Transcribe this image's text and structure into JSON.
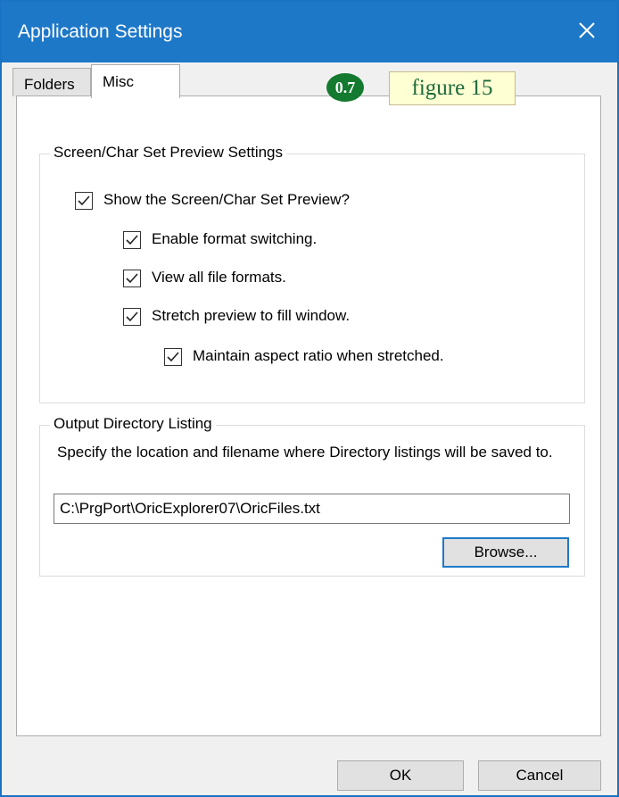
{
  "window": {
    "title": "Application Settings"
  },
  "tabs": [
    {
      "label": "Folders",
      "selected": false
    },
    {
      "label": "Misc",
      "selected": true
    }
  ],
  "annotation": {
    "badge": "0.7",
    "figure_label": "figure 15"
  },
  "preview_group": {
    "legend": "Screen/Char Set Preview Settings",
    "options": [
      {
        "label": "Show the Screen/Char Set Preview?",
        "checked": true
      },
      {
        "label": "Enable format switching.",
        "checked": true
      },
      {
        "label": "View all file formats.",
        "checked": true
      },
      {
        "label": "Stretch preview to fill window.",
        "checked": true
      },
      {
        "label": "Maintain aspect ratio when stretched.",
        "checked": true
      }
    ]
  },
  "output_group": {
    "legend": "Output Directory Listing",
    "description": "Specify the location and filename where Directory listings will be saved to.",
    "path_value": "C:\\PrgPort\\OricExplorer07\\OricFiles.txt",
    "browse_label": "Browse..."
  },
  "footer": {
    "ok_label": "OK",
    "cancel_label": "Cancel"
  },
  "colors": {
    "titlebar": "#1e78c8",
    "badge": "#137a2f",
    "figure_label_bg": "#ffffd4"
  },
  "icons": {
    "close": "close-icon",
    "check": "checkmark-icon"
  }
}
